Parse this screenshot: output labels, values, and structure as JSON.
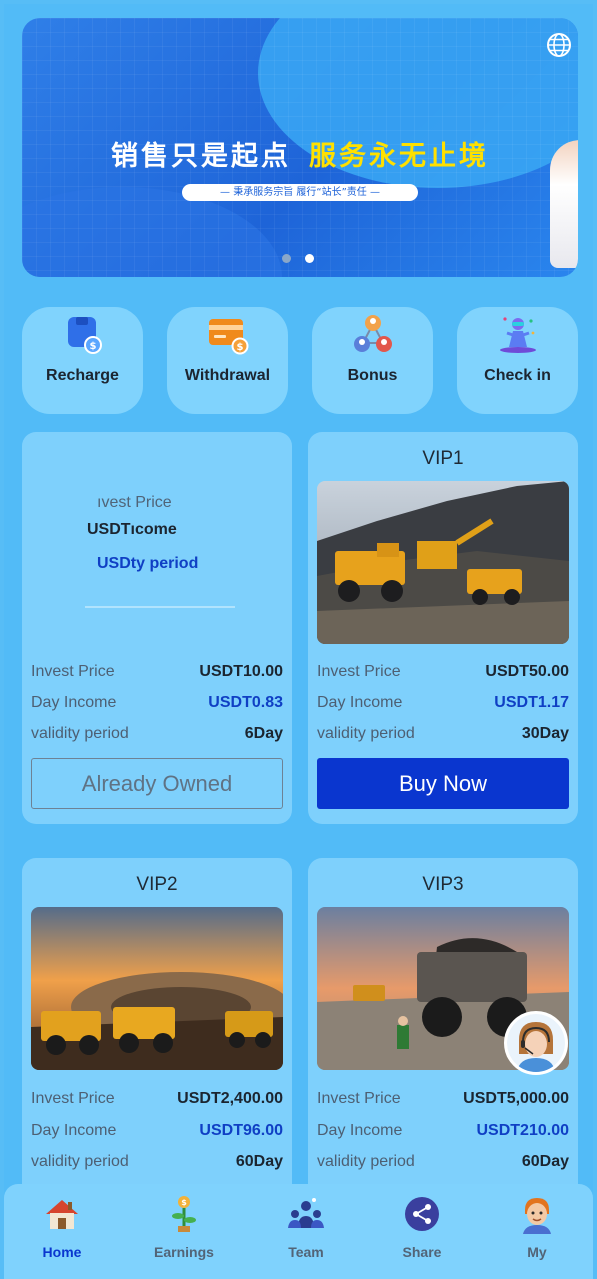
{
  "banner": {
    "headline_white": "销售只是起点",
    "headline_yellow": "服务永无止境",
    "tagline": "— 秉承服务宗旨 履行“站长”责任 —",
    "slides": 2,
    "active_slide": 2
  },
  "actions": [
    {
      "label": "Recharge",
      "icon": "wallet-icon"
    },
    {
      "label": "Withdrawal",
      "icon": "card-icon"
    },
    {
      "label": "Bonus",
      "icon": "bonus-icon"
    },
    {
      "label": "Check in",
      "icon": "check-in-icon"
    }
  ],
  "vip0": {
    "overlay_lines": [
      "ıvest Price",
      "USDTıcome",
      "USDty period"
    ],
    "rows": [
      {
        "k": "Invest Price",
        "v": "USDT10.00"
      },
      {
        "k": "Day Income",
        "v": "USDT0.83"
      },
      {
        "k": "validity period",
        "v": "6Day"
      }
    ],
    "button": "Already Owned"
  },
  "vip1": {
    "title": "VIP1",
    "rows": [
      {
        "k": "Invest Price",
        "v": "USDT50.00"
      },
      {
        "k": "Day Income",
        "v": "USDT1.17"
      },
      {
        "k": "validity period",
        "v": "30Day"
      }
    ],
    "button": "Buy Now"
  },
  "vip2": {
    "title": "VIP2",
    "rows": [
      {
        "k": "Invest Price",
        "v": "USDT2,400.00"
      },
      {
        "k": "Day Income",
        "v": "USDT96.00"
      },
      {
        "k": "validity period",
        "v": "60Day"
      }
    ]
  },
  "vip3": {
    "title": "VIP3",
    "rows": [
      {
        "k": "Invest Price",
        "v": "USDT5,000.00"
      },
      {
        "k": "Day Income",
        "v": "USDT210.00"
      },
      {
        "k": "validity period",
        "v": "60Day"
      }
    ]
  },
  "nav": [
    {
      "label": "Home",
      "icon": "home-icon",
      "active": true
    },
    {
      "label": "Earnings",
      "icon": "earnings-icon"
    },
    {
      "label": "Team",
      "icon": "team-icon"
    },
    {
      "label": "Share",
      "icon": "share-icon"
    },
    {
      "label": "My",
      "icon": "profile-icon"
    }
  ],
  "colors": {
    "background": "#52bbf7",
    "card": "#7ed0fc",
    "accent": "#0a36cf",
    "income": "#0f3fc4",
    "banner_yellow": "#ffe000"
  }
}
